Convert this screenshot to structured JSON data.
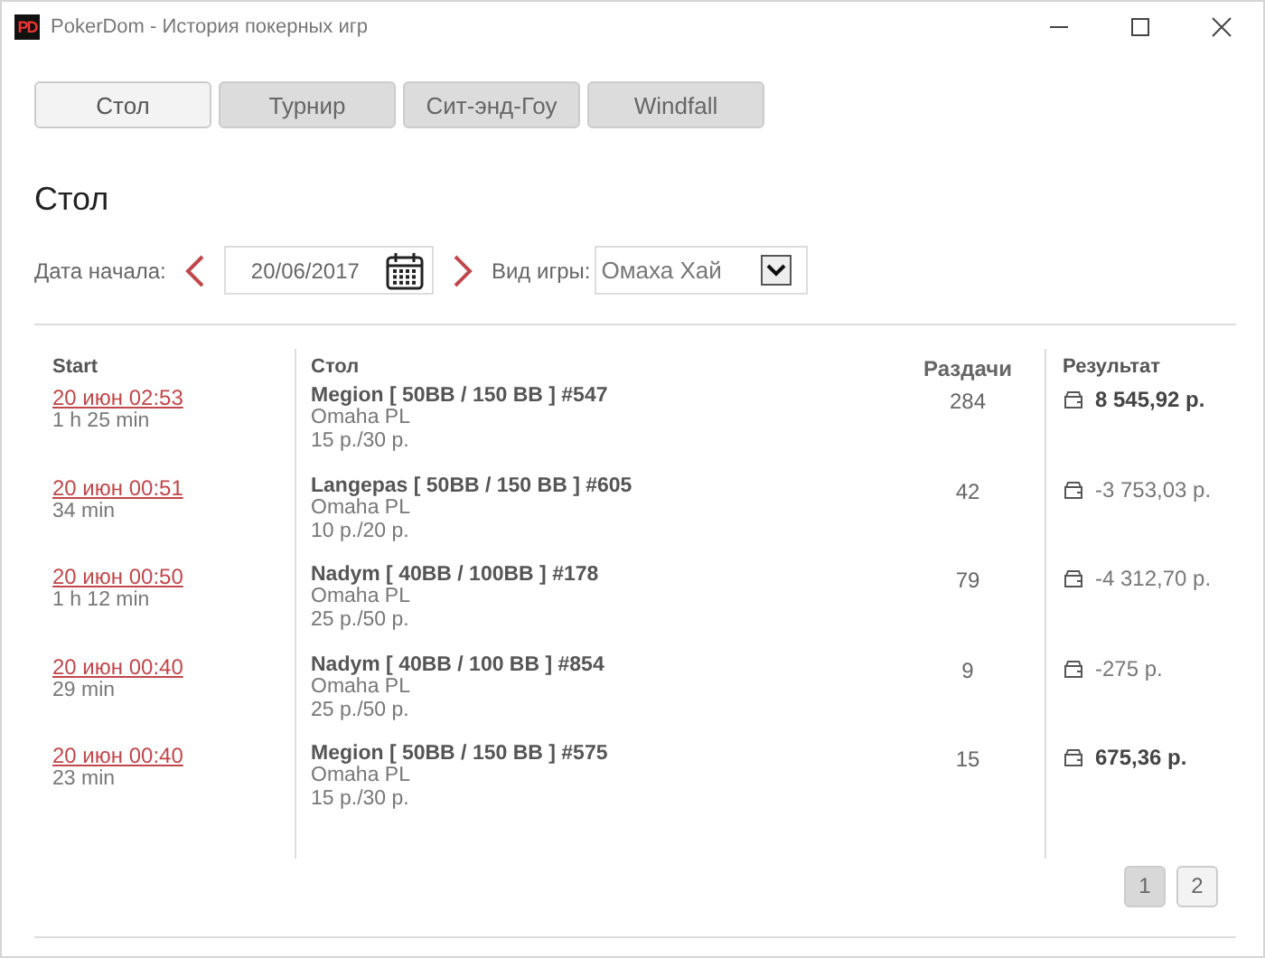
{
  "window": {
    "title": "PokerDom - История покерных игр",
    "logo": "PD"
  },
  "tabs": [
    {
      "label": "Стол",
      "selected": true
    },
    {
      "label": "Турнир",
      "selected": false
    },
    {
      "label": "Сит-энд-Гоу",
      "selected": false
    },
    {
      "label": "Windfall",
      "selected": false
    }
  ],
  "heading": "Стол",
  "filters": {
    "date_label": "Дата начала:",
    "date_value": "20/06/2017",
    "game_label": "Вид игры:",
    "game_value": "Омаха Хай"
  },
  "table": {
    "columns": [
      "Start",
      "Стол",
      "Раздачи",
      "Результат"
    ],
    "rows": [
      {
        "start": "20 июн 02:53",
        "duration": "1 h 25 min",
        "table": "Megion [ 50BB / 150 BB ] #547",
        "game": "Omaha PL",
        "stakes": "15 р./30 р.",
        "hands": "284",
        "result": "8 545,92 р.",
        "positive": true
      },
      {
        "start": "20 июн 00:51",
        "duration": "34 min",
        "table": "Langepas [ 50BB / 150 BB ] #605",
        "game": "Omaha PL",
        "stakes": "10 р./20 р.",
        "hands": "42",
        "result": "-3 753,03 р.",
        "positive": false
      },
      {
        "start": "20 июн 00:50",
        "duration": "1 h 12 min",
        "table": "Nadym [ 40BB / 100BB ] #178",
        "game": "Omaha PL",
        "stakes": "25 р./50 р.",
        "hands": "79",
        "result": "-4 312,70 р.",
        "positive": false
      },
      {
        "start": "20 июн 00:40",
        "duration": "29 min",
        "table": "Nadym [ 40BB / 100 BB ] #854",
        "game": "Omaha PL",
        "stakes": "25 р./50 р.",
        "hands": "9",
        "result": "-275 р.",
        "positive": false
      },
      {
        "start": "20 июн 00:40",
        "duration": "23 min",
        "table": "Megion [ 50BB / 150 BB ] #575",
        "game": "Omaha PL",
        "stakes": "15 р./30 р.",
        "hands": "15",
        "result": "675,36 р.",
        "positive": true
      }
    ]
  },
  "pages": [
    {
      "label": "1",
      "selected": true
    },
    {
      "label": "2",
      "selected": false
    }
  ]
}
